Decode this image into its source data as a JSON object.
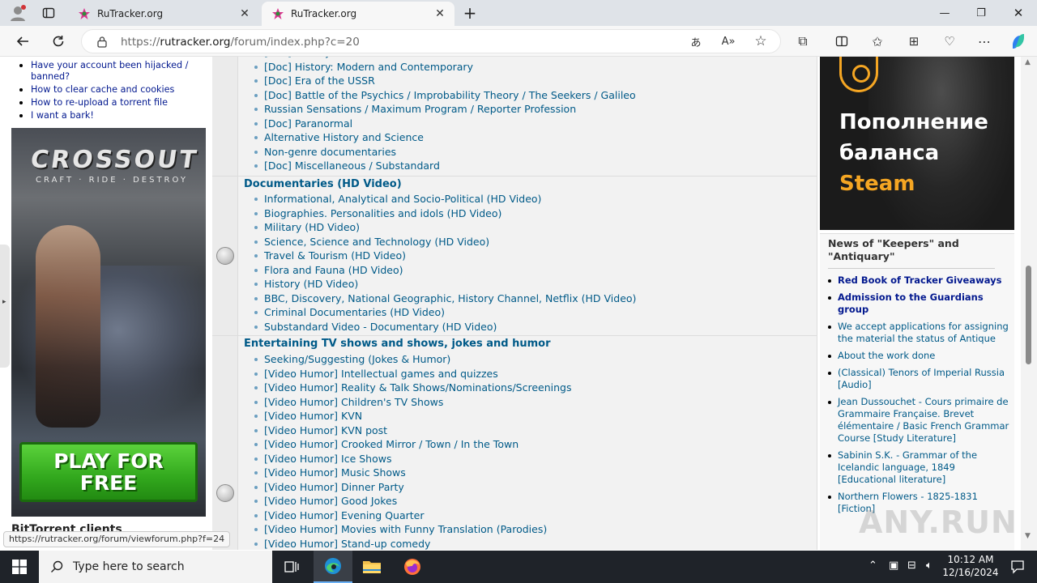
{
  "browser": {
    "tabs": [
      {
        "title": "RuTracker.org",
        "active": false
      },
      {
        "title": "RuTracker.org",
        "active": true
      }
    ],
    "url_prefix": "https://",
    "url_host": "rutracker.org",
    "url_path": "/forum/index.php?c=20",
    "status_url": "https://rutracker.org/forum/viewforum.php?f=24"
  },
  "left_sidebar": {
    "links": [
      "Have your account been hijacked / banned?",
      "How to clear cache and cookies",
      "How to re-upload a torrent file",
      "I want a bark!"
    ],
    "ad": {
      "logo": "CROSSOUT",
      "tagline": "CRAFT · RIDE · DESTROY",
      "cta": "PLAY FOR FREE"
    },
    "bottom_heading": "BitTorrent clients"
  },
  "forum": {
    "top_items": [
      "[Doc] History: Modern and Contemporary",
      "[Doc] Era of the USSR",
      "[Doc] Battle of the Psychics / Improbability Theory / The Seekers / Galileo",
      "Russian Sensations / Maximum Program / Reporter Profession",
      "[Doc] Paranormal",
      "Alternative History and Science",
      "Non-genre documentaries",
      "[Doc] Miscellaneous / Substandard"
    ],
    "categories": [
      {
        "title": "Documentaries (HD Video)",
        "items": [
          "Informational, Analytical and Socio-Political (HD Video)",
          "Biographies. Personalities and idols (HD Video)",
          "Military (HD Video)",
          "Science, Science and Technology (HD Video)",
          "Travel & Tourism (HD Video)",
          "Flora and Fauna (HD Video)",
          "History (HD Video)",
          "BBC, Discovery, National Geographic, History Channel, Netflix (HD Video)",
          "Criminal Documentaries (HD Video)",
          "Substandard Video - Documentary (HD Video)"
        ]
      },
      {
        "title": "Entertaining TV shows and shows, jokes and humor",
        "items": [
          "Seeking/Suggesting (Jokes & Humor)",
          "[Video Humor] Intellectual games and quizzes",
          "[Video Humor] Reality & Talk Shows/Nominations/Screenings",
          "[Video Humor] Children's TV Shows",
          "[Video Humor] KVN",
          "[Video Humor] KVN post",
          "[Video Humor] Crooked Mirror / Town / In the Town",
          "[Video Humor] Ice Shows",
          "[Video Humor] Music Shows",
          "[Video Humor] Dinner Party",
          "[Video Humor] Good Jokes",
          "[Video Humor] Evening Quarter",
          "[Video Humor] Movies with Funny Translation (Parodies)",
          "[Video Humor] Stand-up comedy"
        ]
      }
    ]
  },
  "right_sidebar": {
    "ad": {
      "line1": "Пополнение",
      "line2": "баланса",
      "line3": "Steam"
    },
    "news_title": "News of \"Keepers\" and \"Antiquary\"",
    "news": [
      {
        "text": "Red Book of Tracker Giveaways",
        "bold": true
      },
      {
        "text": "Admission to the Guardians group",
        "bold": true
      },
      {
        "text": "We accept applications for assigning the material the status of Antique",
        "bold": false
      },
      {
        "text": "About the work done",
        "bold": false
      },
      {
        "text": "(Classical) Tenors of Imperial Russia [Audio]",
        "bold": false
      },
      {
        "text": "Jean Dussouchet - Cours primaire de Grammaire Française. Brevet élémentaire / Basic French Grammar Course [Study Literature]",
        "bold": false
      },
      {
        "text": "Sabinin S.K. - Grammar of the Icelandic language, 1849 [Educational literature]",
        "bold": false
      },
      {
        "text": "Northern Flowers - 1825-1831 [Fiction]",
        "bold": false
      }
    ]
  },
  "watermark": "ANY.RUN",
  "taskbar": {
    "search_placeholder": "Type here to search",
    "time": "10:12 AM",
    "date": "12/16/2024"
  },
  "colors": {
    "link": "#005a88",
    "accent_steam": "#f5a623",
    "play_green": "#32a81d"
  }
}
